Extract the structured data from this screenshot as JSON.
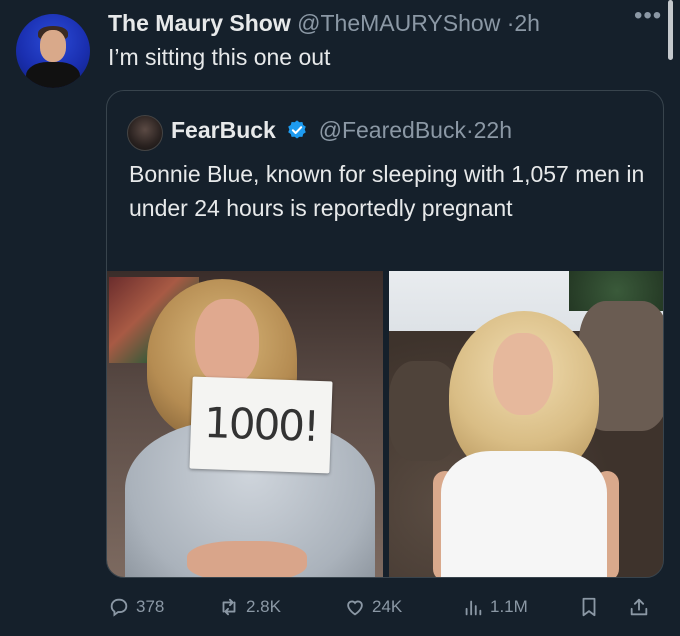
{
  "tweet": {
    "author_name": "The Maury Show",
    "author_handle": "@TheMAURYShow",
    "time": "2h",
    "text": "I’m sitting this one out"
  },
  "quoted": {
    "author_name": "FearBuck",
    "author_handle": "@FearedBuck",
    "time": "22h",
    "text": "Bonnie Blue, known for sleeping with 1,057 men in under 24 hours is reportedly pregnant",
    "image_left_sign": "1000!"
  },
  "actions": {
    "replies": "378",
    "reposts": "2.8K",
    "likes": "24K",
    "views": "1.1M"
  },
  "icons": [
    "more-icon",
    "verified-icon",
    "reply-icon",
    "repost-icon",
    "like-icon",
    "views-icon",
    "bookmark-icon",
    "share-icon"
  ],
  "colors": {
    "background": "#15202b",
    "text": "#e7e9ea",
    "secondary": "#8b98a5",
    "verified": "#1d9bf0",
    "border": "#38444d"
  }
}
